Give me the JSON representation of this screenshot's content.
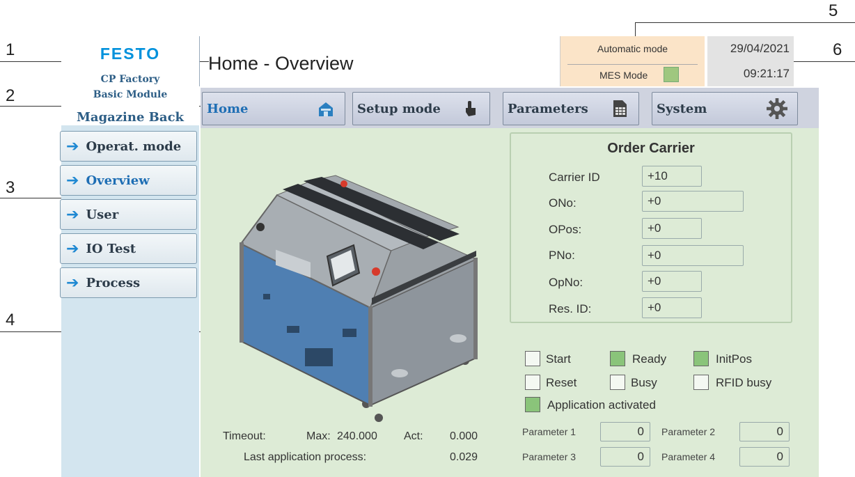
{
  "callouts": [
    "1",
    "2",
    "3",
    "4",
    "5",
    "6"
  ],
  "logo": {
    "brand": "FESTO",
    "line1": "CP Factory",
    "line2": "Basic Module",
    "station": "Magazine Back"
  },
  "header": {
    "title": "Home - Overview",
    "automatic_mode": "Automatic mode",
    "mes_mode": "MES Mode",
    "mes_led_color": "#9fc77f",
    "date": "29/04/2021",
    "time": "09:21:17"
  },
  "nav": {
    "tabs": [
      {
        "label": "Home",
        "icon": "house-icon"
      },
      {
        "label": "Setup mode",
        "icon": "hand-pointer-icon"
      },
      {
        "label": "Parameters",
        "icon": "document-table-icon"
      },
      {
        "label": "System",
        "icon": "gear-icon"
      }
    ]
  },
  "sidebar": {
    "items": [
      {
        "label": "Operat. mode"
      },
      {
        "label": "Overview"
      },
      {
        "label": "User"
      },
      {
        "label": "IO Test"
      },
      {
        "label": "Process"
      }
    ]
  },
  "order_carrier": {
    "title": "Order Carrier",
    "fields": [
      {
        "label": "Carrier ID",
        "value": "+10"
      },
      {
        "label": "ONo:",
        "value": "+0"
      },
      {
        "label": "OPos:",
        "value": "+0"
      },
      {
        "label": "PNo:",
        "value": "+0"
      },
      {
        "label": "OpNo:",
        "value": "+0"
      },
      {
        "label": "Res. ID:",
        "value": "+0"
      }
    ]
  },
  "status": {
    "items": [
      {
        "label": "Start",
        "on": false
      },
      {
        "label": "Ready",
        "on": true
      },
      {
        "label": "InitPos",
        "on": true
      },
      {
        "label": "Reset",
        "on": false
      },
      {
        "label": "Busy",
        "on": false
      },
      {
        "label": "RFID busy",
        "on": false
      },
      {
        "label": "Application activated",
        "on": true
      }
    ],
    "on_color": "#8ac47a"
  },
  "parameters": [
    {
      "label": "Parameter 1",
      "value": "0"
    },
    {
      "label": "Parameter 2",
      "value": "0"
    },
    {
      "label": "Parameter 3",
      "value": "0"
    },
    {
      "label": "Parameter 4",
      "value": "0"
    }
  ],
  "timeout": {
    "label": "Timeout:",
    "max_label": "Max:",
    "max_value": "240.000",
    "act_label": "Act:",
    "act_value": "0.000",
    "last_label": "Last application process:",
    "last_value": "0.029"
  }
}
